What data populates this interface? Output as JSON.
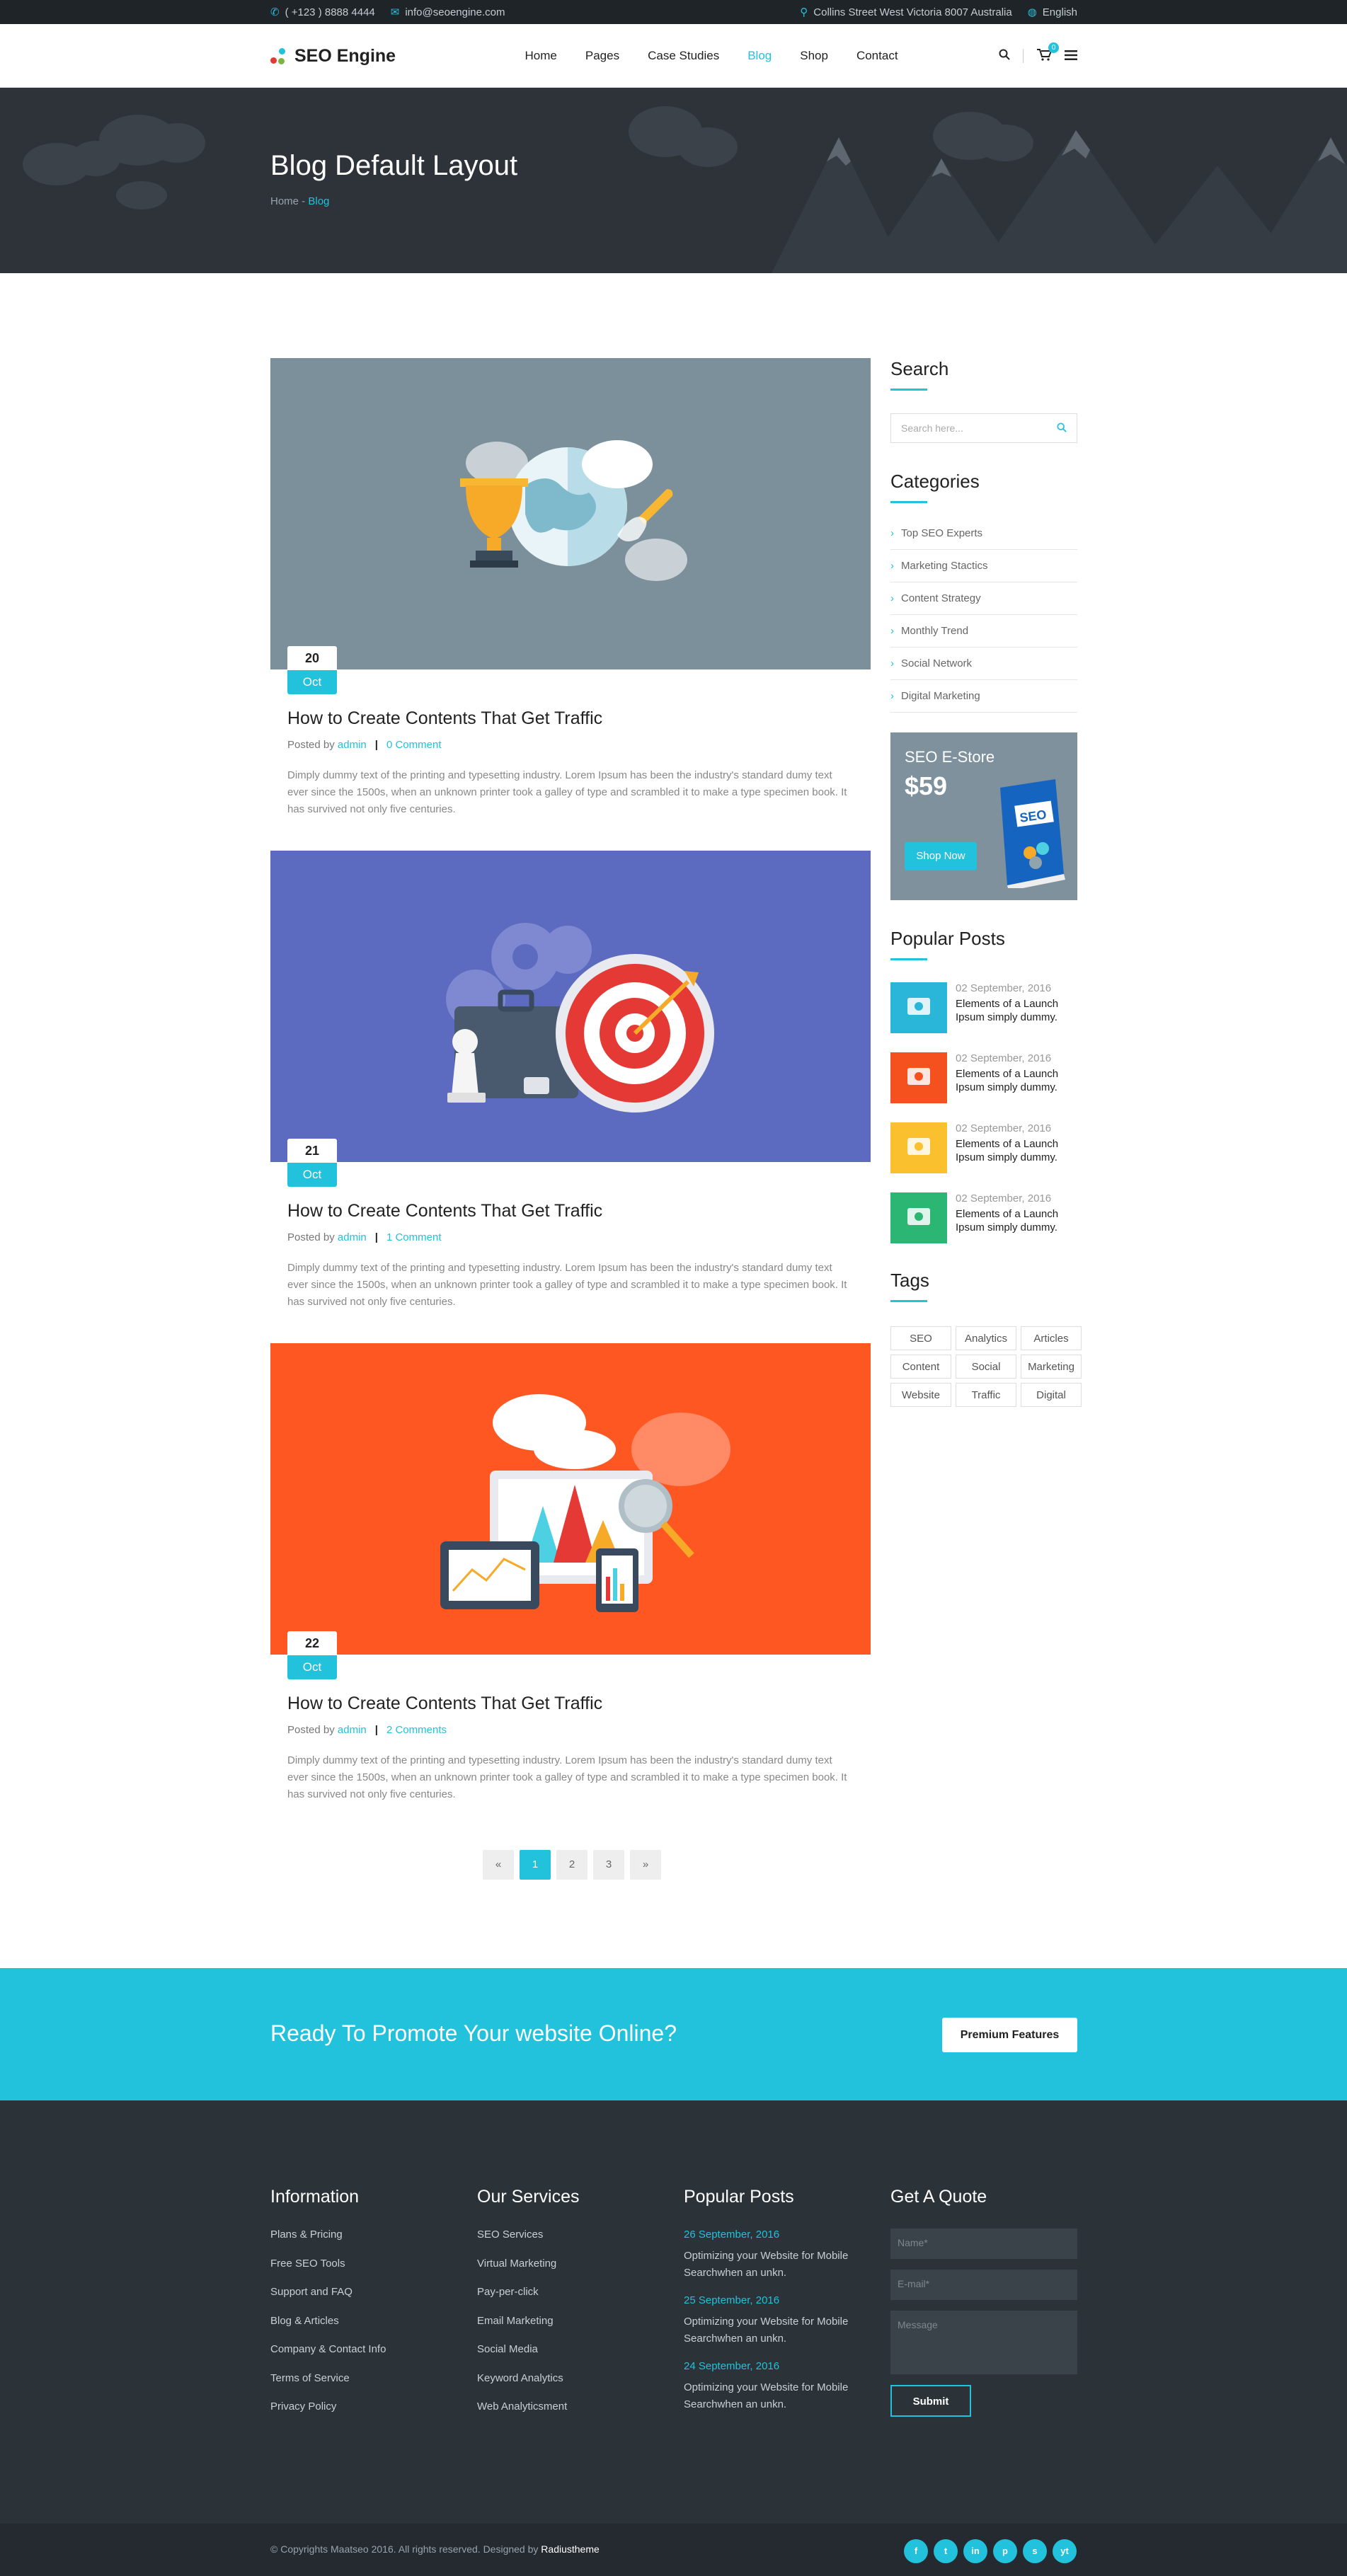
{
  "topbar": {
    "phone": "( +123 ) 8888 4444",
    "email": "info@seoengine.com",
    "address": "Collins Street West Victoria 8007 Australia",
    "language": "English"
  },
  "header": {
    "logo": "SEO Engine",
    "nav": [
      "Home",
      "Pages",
      "Case Studies",
      "Blog",
      "Shop",
      "Contact"
    ],
    "active_nav": "Blog",
    "cart_count": "0"
  },
  "banner": {
    "title": "Blog Default Layout",
    "breadcrumb_home": "Home",
    "breadcrumb_sep": " - ",
    "breadcrumb_current": "Blog"
  },
  "posts": [
    {
      "day": "20",
      "month": "Oct",
      "title": "How to Create Contents That Get Traffic",
      "posted_by": "Posted by",
      "author": "admin",
      "comments": "0 Comment",
      "excerpt": "Dimply dummy text of the printing and typesetting industry. Lorem Ipsum has been the industry's standard dumy text ever since the 1500s, when an unknown printer took a galley of type and scrambled it to make a type specimen book. It has survived not only five centuries.",
      "bg": "#7b909b"
    },
    {
      "day": "21",
      "month": "Oct",
      "title": "How to Create Contents That Get Traffic",
      "posted_by": "Posted by",
      "author": "admin",
      "comments": "1 Comment",
      "excerpt": "Dimply dummy text of the printing and typesetting industry. Lorem Ipsum has been the industry's standard dumy text ever since the 1500s, when an unknown printer took a galley of type and scrambled it to make a type specimen book. It has survived not only five centuries.",
      "bg": "#5c6bc0"
    },
    {
      "day": "22",
      "month": "Oct",
      "title": "How to Create Contents That Get Traffic",
      "posted_by": "Posted by",
      "author": "admin",
      "comments": "2 Comments",
      "excerpt": "Dimply dummy text of the printing and typesetting industry. Lorem Ipsum has been the industry's standard dumy text ever since the 1500s, when an unknown printer took a galley of type and scrambled it to make a type specimen book. It has survived not only five centuries.",
      "bg": "#ff5722"
    }
  ],
  "pagination": [
    "«",
    "1",
    "2",
    "3",
    "»"
  ],
  "pagination_active": "1",
  "sidebar": {
    "search_title": "Search",
    "search_placeholder": "Search here...",
    "categories_title": "Categories",
    "categories": [
      "Top SEO Experts",
      "Marketing Stactics",
      "Content Strategy",
      "Monthly Trend",
      "Social Network",
      "Digital Marketing"
    ],
    "store": {
      "title": "SEO E-Store",
      "price": "$59",
      "button": "Shop Now",
      "book_title": "SEO"
    },
    "popular_title": "Popular Posts",
    "popular": [
      {
        "date": "02 September, 2016",
        "title": "Elements of a Launch Ipsum simply dummy.",
        "color": "#29b6d8"
      },
      {
        "date": "02 September, 2016",
        "title": "Elements of a Launch Ipsum simply dummy.",
        "color": "#f4511e"
      },
      {
        "date": "02 September, 2016",
        "title": "Elements of a Launch Ipsum simply dummy.",
        "color": "#fbc02d"
      },
      {
        "date": "02 September, 2016",
        "title": "Elements of a Launch Ipsum simply dummy.",
        "color": "#2bb673"
      }
    ],
    "tags_title": "Tags",
    "tags": [
      "SEO",
      "Analytics",
      "Articles",
      "Content",
      "Social",
      "Marketing",
      "Website",
      "Traffic",
      "Digital"
    ]
  },
  "cta": {
    "text": "Ready To Promote Your website Online?",
    "button": "Premium Features"
  },
  "footer": {
    "info_title": "Information",
    "info_links": [
      "Plans & Pricing",
      "Free SEO Tools",
      "Support and FAQ",
      "Blog & Articles",
      "Company & Contact Info",
      "Terms of Service",
      "Privacy Policy"
    ],
    "services_title": "Our Services",
    "services_links": [
      "SEO Services",
      "Virtual Marketing",
      "Pay-per-click",
      "Email Marketing",
      "Social Media",
      "Keyword Analytics",
      "Web Analyticsment"
    ],
    "popular_title": "Popular Posts",
    "popular": [
      {
        "date": "26 September, 2016",
        "text": "Optimizing your Website for Mobile Searchwhen an unkn."
      },
      {
        "date": "25 September, 2016",
        "text": "Optimizing your Website for Mobile Searchwhen an unkn."
      },
      {
        "date": "24 September, 2016",
        "text": "Optimizing your Website for Mobile Searchwhen an unkn."
      }
    ],
    "quote_title": "Get A Quote",
    "name_placeholder": "Name*",
    "email_placeholder": "E-mail*",
    "message_placeholder": "Message",
    "submit": "Submit"
  },
  "bottom": {
    "copyright": "© Copyrights Maatseo 2016. All rights reserved. Designed by",
    "brand": "Radiustheme",
    "social": [
      "f",
      "t",
      "in",
      "p",
      "s",
      "yt"
    ]
  }
}
